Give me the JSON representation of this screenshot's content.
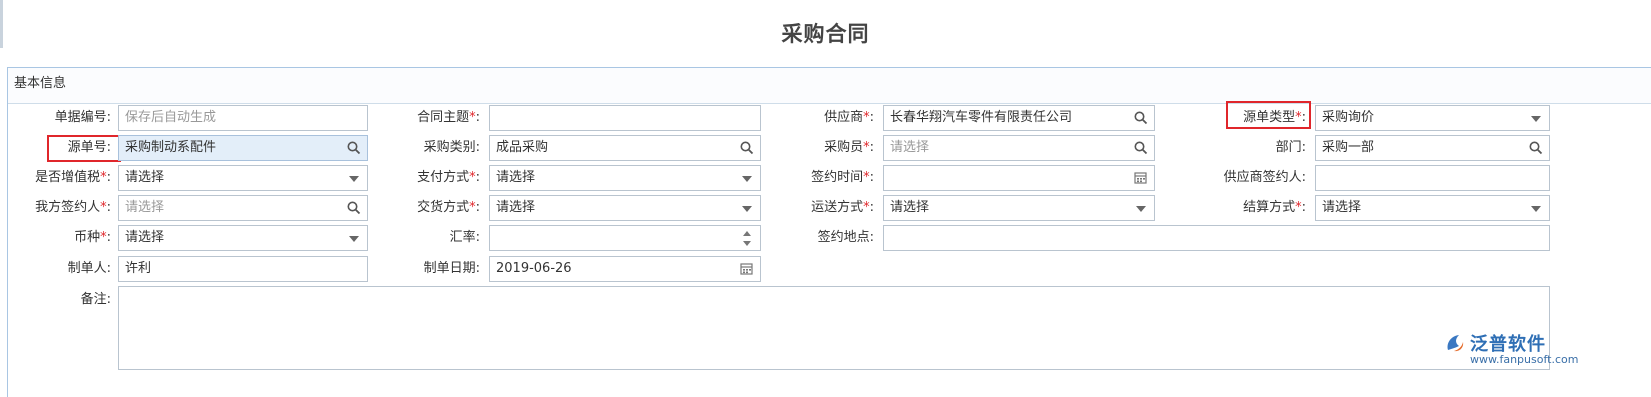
{
  "page": {
    "title": "采购合同"
  },
  "panel": {
    "header": "基本信息"
  },
  "fields": {
    "doc_no": {
      "label": "单据编号:",
      "value": "保存后自动生成"
    },
    "subject": {
      "label": "合同主题",
      "required": "*",
      "colon": ":",
      "value": ""
    },
    "supplier": {
      "label": "供应商",
      "required": "*",
      "colon": ":",
      "value": "长春华翔汽车零件有限责任公司"
    },
    "source_type": {
      "label": "源单类型",
      "required": "*",
      "colon": ":",
      "value": "采购询价"
    },
    "source_no": {
      "label": "源单号:",
      "value": "采购制动系配件"
    },
    "purchase_cat": {
      "label": "采购类别:",
      "value": "成品采购"
    },
    "buyer": {
      "label": "采购员",
      "required": "*",
      "colon": ":",
      "value": "请选择"
    },
    "dept": {
      "label": "部门:",
      "value": "采购一部"
    },
    "vat": {
      "label": "是否增值税",
      "required": "*",
      "colon": ":",
      "value": "请选择"
    },
    "payment": {
      "label": "支付方式",
      "required": "*",
      "colon": ":",
      "value": "请选择"
    },
    "sign_time": {
      "label": "签约时间",
      "required": "*",
      "colon": ":",
      "value": ""
    },
    "supplier_signer": {
      "label": "供应商签约人:",
      "value": ""
    },
    "our_signer": {
      "label": "我方签约人",
      "required": "*",
      "colon": ":",
      "value": "请选择"
    },
    "delivery": {
      "label": "交货方式",
      "required": "*",
      "colon": ":",
      "value": "请选择"
    },
    "shipping": {
      "label": "运送方式",
      "required": "*",
      "colon": ":",
      "value": "请选择"
    },
    "settlement": {
      "label": "结算方式",
      "required": "*",
      "colon": ":",
      "value": "请选择"
    },
    "currency": {
      "label": "币种",
      "required": "*",
      "colon": ":",
      "value": "请选择"
    },
    "rate": {
      "label": "汇率:",
      "value": ""
    },
    "sign_place": {
      "label": "签约地点:",
      "value": ""
    },
    "creator": {
      "label": "制单人:",
      "value": "许利"
    },
    "create_date": {
      "label": "制单日期:",
      "value": "2019-06-26"
    },
    "remark": {
      "label": "备注:",
      "value": ""
    }
  },
  "logo": {
    "brand": "泛普软件",
    "url": "www.fanpusoft.com"
  },
  "colors": {
    "required_star": "#e0262b",
    "highlight_box": "#e0262b",
    "panel_border": "#a9c6e3"
  },
  "icons": [
    "search-icon",
    "chevron-down-icon",
    "calendar-icon",
    "spinner-icon"
  ]
}
